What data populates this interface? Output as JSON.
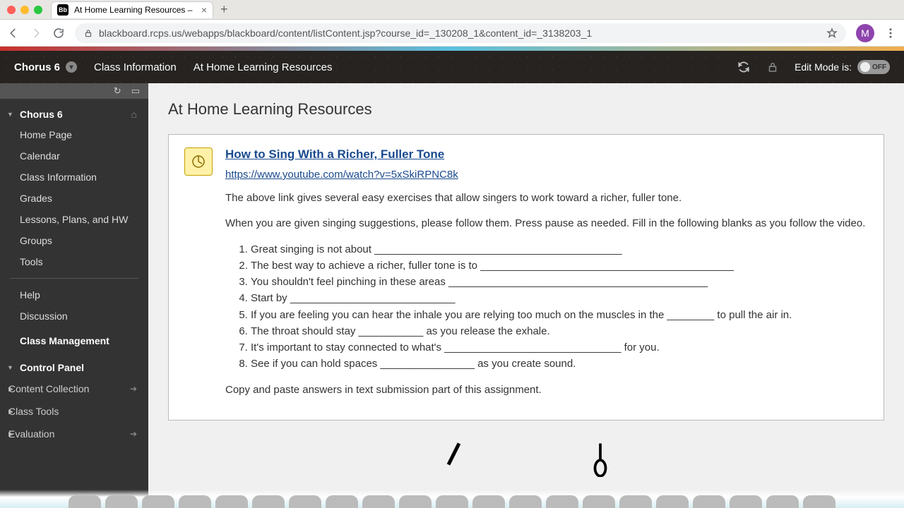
{
  "browser": {
    "tab_title": "At Home Learning Resources –",
    "url": "blackboard.rcps.us/webapps/blackboard/content/listContent.jsp?course_id=_130208_1&content_id=_3138203_1",
    "avatar_letter": "M"
  },
  "header": {
    "course_name": "Chorus 6",
    "nav": [
      "Class Information",
      "At Home Learning Resources"
    ],
    "edit_label": "Edit Mode is:",
    "edit_state": "OFF"
  },
  "sidebar": {
    "course": "Chorus 6",
    "menu": [
      "Home Page",
      "Calendar",
      "Class Information",
      "Grades",
      "Lessons, Plans, and HW",
      "Groups",
      "Tools"
    ],
    "extra": [
      "Help",
      "Discussion"
    ],
    "mgmt_heading": "Class Management",
    "cp_heading": "Control Panel",
    "cp_items": [
      "Content Collection",
      "Class Tools",
      "Evaluation"
    ]
  },
  "content": {
    "page_title": "At Home Learning Resources",
    "item_title": "How to Sing With a Richer, Fuller Tone",
    "item_url": "https://www.youtube.com/watch?v=5xSkiRPNC8k",
    "intro": "The above link gives several easy exercises that allow singers to work toward a richer, fuller tone.",
    "directions": "When you are given singing suggestions, please follow them. Press pause as needed. Fill in the following blanks as you follow the video.",
    "blanks": [
      "Great singing is not about __________________________________________",
      "The best way to achieve a richer, fuller tone is to ___________________________________________",
      "You shouldn't feel pinching in these areas ____________________________________________",
      "Start by ____________________________",
      "If you are feeling you can hear the inhale you are relying too much on the muscles in the ________ to pull the air in.",
      "The throat should stay ___________ as you release the exhale.",
      "It's important to stay connected to what's ______________________________ for you.",
      "See if you can hold spaces ________________ as you create sound."
    ],
    "closing": "Copy and paste answers in text submission part of this assignment."
  }
}
